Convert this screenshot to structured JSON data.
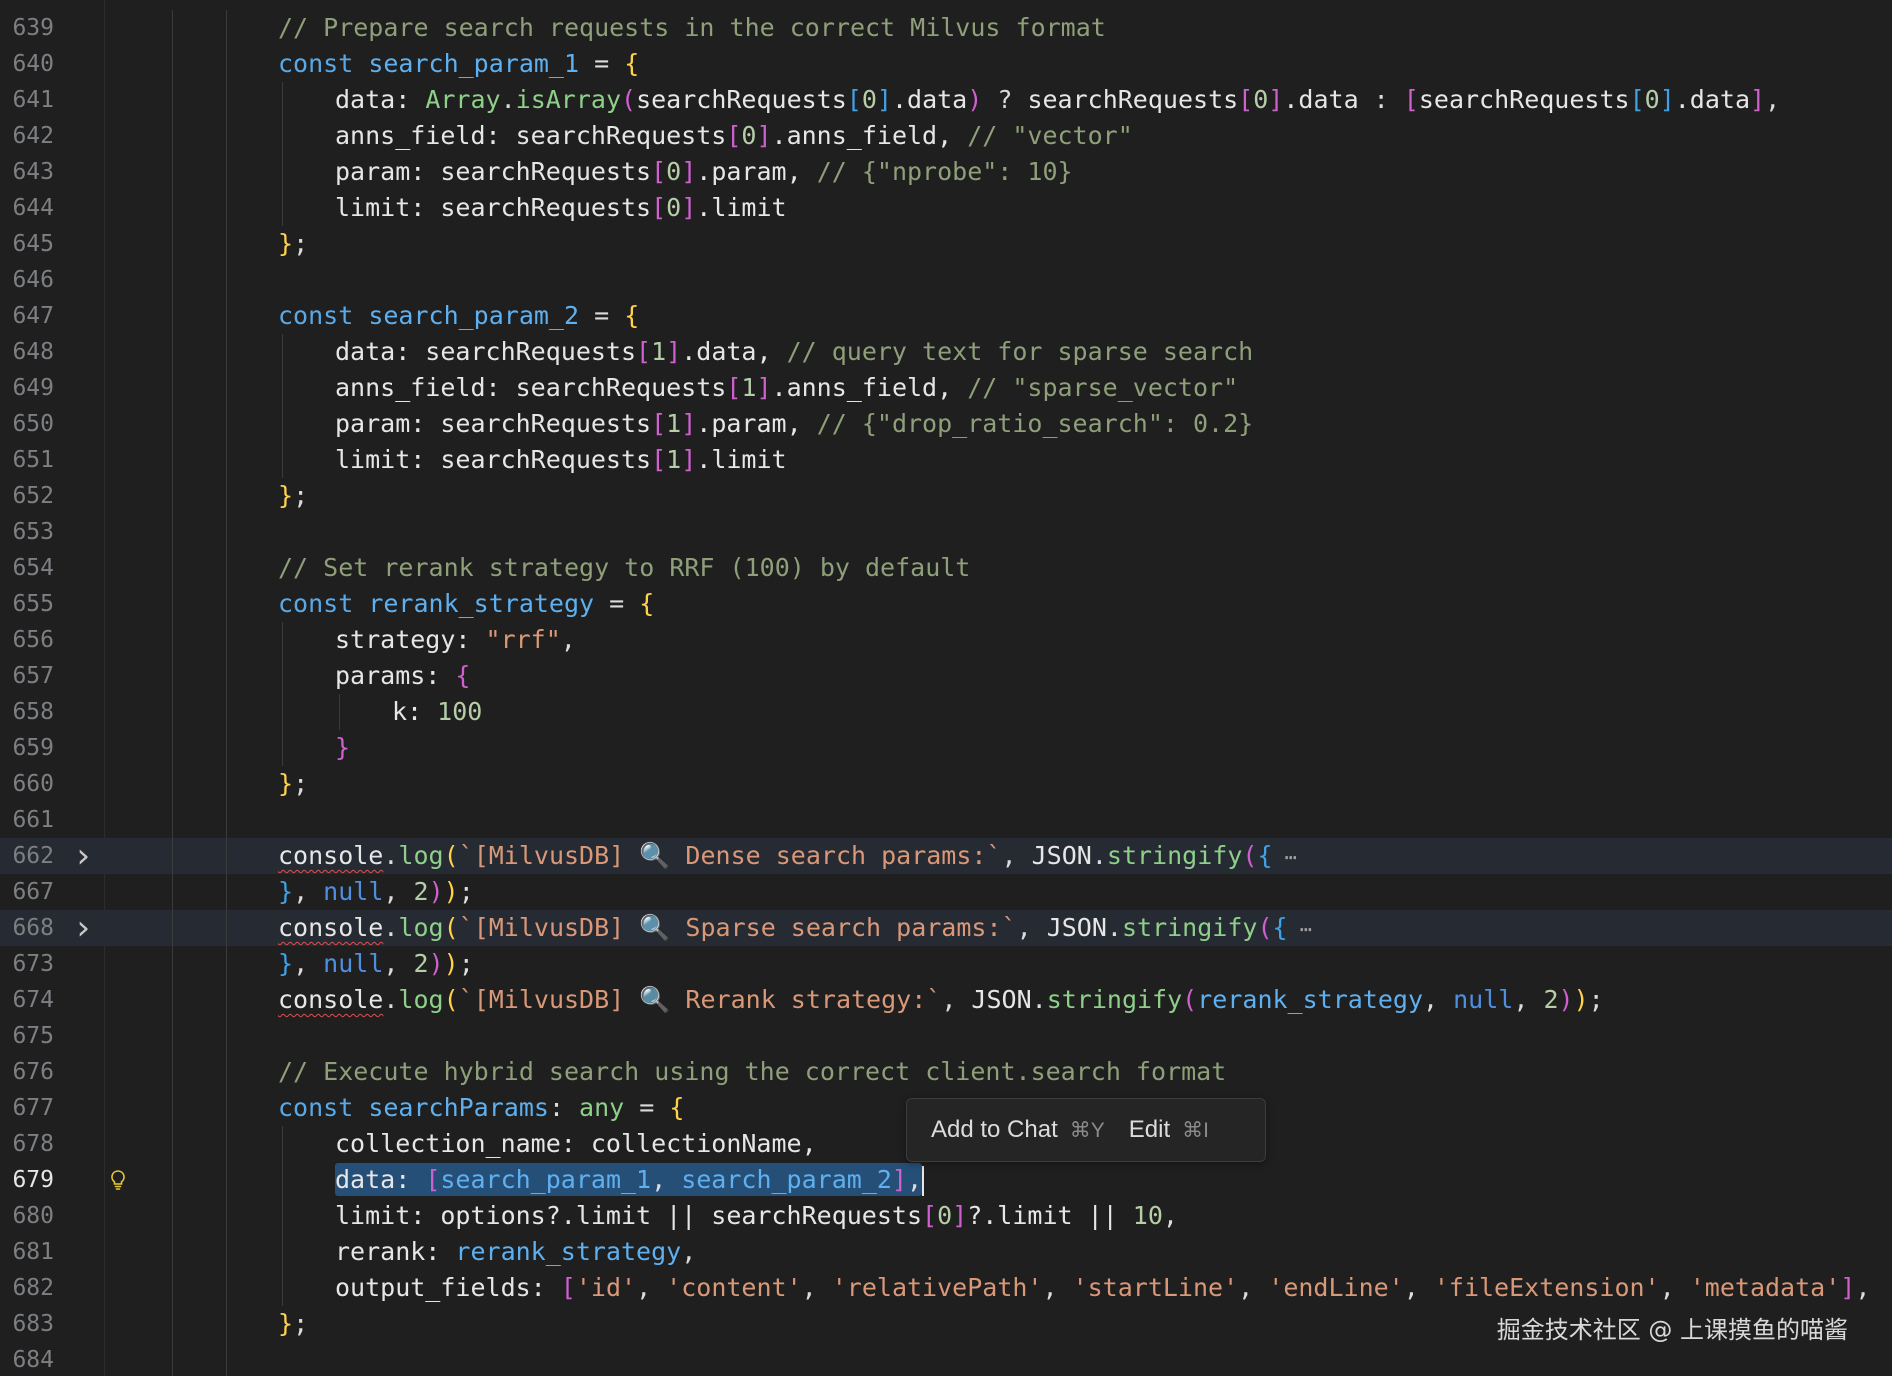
{
  "editor": {
    "lines": [
      {
        "num": "639",
        "tokens": [
          [
            "cm",
            "// Prepare search requests in the correct Milvus format"
          ]
        ],
        "indent": 1
      },
      {
        "num": "640",
        "tokens": [
          [
            "kw",
            "const "
          ],
          [
            "var",
            "search_param_1"
          ],
          [
            "pu",
            " = "
          ],
          [
            "b1",
            "{"
          ]
        ],
        "indent": 1
      },
      {
        "num": "641",
        "tokens": [
          [
            "prop",
            "data: "
          ],
          [
            "type",
            "Array"
          ],
          [
            "pu",
            "."
          ],
          [
            "fn",
            "isArray"
          ],
          [
            "b2",
            "("
          ],
          [
            "prop",
            "searchRequests"
          ],
          [
            "b3",
            "["
          ],
          [
            "num",
            "0"
          ],
          [
            "b3",
            "]"
          ],
          [
            "prop",
            ".data"
          ],
          [
            "b2",
            ")"
          ],
          [
            "pu",
            " ? "
          ],
          [
            "prop",
            "searchRequests"
          ],
          [
            "b2",
            "["
          ],
          [
            "num",
            "0"
          ],
          [
            "b2",
            "]"
          ],
          [
            "prop",
            ".data"
          ],
          [
            "pu",
            " : "
          ],
          [
            "b2",
            "["
          ],
          [
            "prop",
            "searchRequests"
          ],
          [
            "b3",
            "["
          ],
          [
            "num",
            "0"
          ],
          [
            "b3",
            "]"
          ],
          [
            "prop",
            ".data"
          ],
          [
            "b2",
            "]"
          ],
          [
            "pu",
            ","
          ]
        ],
        "indent": 2
      },
      {
        "num": "642",
        "tokens": [
          [
            "prop",
            "anns_field: searchRequests"
          ],
          [
            "b2",
            "["
          ],
          [
            "num",
            "0"
          ],
          [
            "b2",
            "]"
          ],
          [
            "prop",
            ".anns_field, "
          ],
          [
            "cm",
            "// \"vector\""
          ]
        ],
        "indent": 2
      },
      {
        "num": "643",
        "tokens": [
          [
            "prop",
            "param: searchRequests"
          ],
          [
            "b2",
            "["
          ],
          [
            "num",
            "0"
          ],
          [
            "b2",
            "]"
          ],
          [
            "prop",
            ".param, "
          ],
          [
            "cm",
            "// {\"nprobe\": 10}"
          ]
        ],
        "indent": 2
      },
      {
        "num": "644",
        "tokens": [
          [
            "prop",
            "limit: searchRequests"
          ],
          [
            "b2",
            "["
          ],
          [
            "num",
            "0"
          ],
          [
            "b2",
            "]"
          ],
          [
            "prop",
            ".limit"
          ]
        ],
        "indent": 2
      },
      {
        "num": "645",
        "tokens": [
          [
            "b1",
            "}"
          ],
          [
            "pu",
            ";"
          ]
        ],
        "indent": 1
      },
      {
        "num": "646",
        "tokens": [],
        "indent": 1
      },
      {
        "num": "647",
        "tokens": [
          [
            "kw",
            "const "
          ],
          [
            "var",
            "search_param_2"
          ],
          [
            "pu",
            " = "
          ],
          [
            "b1",
            "{"
          ]
        ],
        "indent": 1
      },
      {
        "num": "648",
        "tokens": [
          [
            "prop",
            "data: searchRequests"
          ],
          [
            "b2",
            "["
          ],
          [
            "num",
            "1"
          ],
          [
            "b2",
            "]"
          ],
          [
            "prop",
            ".data, "
          ],
          [
            "cm",
            "// query text for sparse search"
          ]
        ],
        "indent": 2
      },
      {
        "num": "649",
        "tokens": [
          [
            "prop",
            "anns_field: searchRequests"
          ],
          [
            "b2",
            "["
          ],
          [
            "num",
            "1"
          ],
          [
            "b2",
            "]"
          ],
          [
            "prop",
            ".anns_field, "
          ],
          [
            "cm",
            "// \"sparse_vector\""
          ]
        ],
        "indent": 2
      },
      {
        "num": "650",
        "tokens": [
          [
            "prop",
            "param: searchRequests"
          ],
          [
            "b2",
            "["
          ],
          [
            "num",
            "1"
          ],
          [
            "b2",
            "]"
          ],
          [
            "prop",
            ".param, "
          ],
          [
            "cm",
            "// {\"drop_ratio_search\": 0.2}"
          ]
        ],
        "indent": 2
      },
      {
        "num": "651",
        "tokens": [
          [
            "prop",
            "limit: searchRequests"
          ],
          [
            "b2",
            "["
          ],
          [
            "num",
            "1"
          ],
          [
            "b2",
            "]"
          ],
          [
            "prop",
            ".limit"
          ]
        ],
        "indent": 2
      },
      {
        "num": "652",
        "tokens": [
          [
            "b1",
            "}"
          ],
          [
            "pu",
            ";"
          ]
        ],
        "indent": 1
      },
      {
        "num": "653",
        "tokens": [],
        "indent": 1
      },
      {
        "num": "654",
        "tokens": [
          [
            "cm",
            "// Set rerank strategy to RRF (100) by default"
          ]
        ],
        "indent": 1
      },
      {
        "num": "655",
        "tokens": [
          [
            "kw",
            "const "
          ],
          [
            "var",
            "rerank_strategy"
          ],
          [
            "pu",
            " = "
          ],
          [
            "b1",
            "{"
          ]
        ],
        "indent": 1
      },
      {
        "num": "656",
        "tokens": [
          [
            "prop",
            "strategy: "
          ],
          [
            "str",
            "\"rrf\""
          ],
          [
            "pu",
            ","
          ]
        ],
        "indent": 2
      },
      {
        "num": "657",
        "tokens": [
          [
            "prop",
            "params: "
          ],
          [
            "b2",
            "{"
          ]
        ],
        "indent": 2
      },
      {
        "num": "658",
        "tokens": [
          [
            "prop",
            "k: "
          ],
          [
            "num",
            "100"
          ]
        ],
        "indent": 3
      },
      {
        "num": "659",
        "tokens": [
          [
            "b2",
            "}"
          ]
        ],
        "indent": 2
      },
      {
        "num": "660",
        "tokens": [
          [
            "b1",
            "}"
          ],
          [
            "pu",
            ";"
          ]
        ],
        "indent": 1
      },
      {
        "num": "661",
        "tokens": [],
        "indent": 1
      },
      {
        "num": "662",
        "fold": true,
        "tokens": [
          [
            "sq",
            "console"
          ],
          [
            "pu",
            "."
          ],
          [
            "fn",
            "log"
          ],
          [
            "b1",
            "("
          ],
          [
            "str",
            "`[MilvusDB] 🔍 Dense search params:`"
          ],
          [
            "pu",
            ", "
          ],
          [
            "prop",
            "JSON"
          ],
          [
            "pu",
            "."
          ],
          [
            "fn",
            "stringify"
          ],
          [
            "b2",
            "("
          ],
          [
            "b3",
            "{"
          ],
          [
            "el",
            " ⋯"
          ]
        ],
        "indent": 1
      },
      {
        "num": "667",
        "tokens": [
          [
            "b3",
            "}"
          ],
          [
            "pu",
            ", "
          ],
          [
            "null",
            "null"
          ],
          [
            "pu",
            ", "
          ],
          [
            "num",
            "2"
          ],
          [
            "b2",
            ")"
          ],
          [
            "b1",
            ")"
          ],
          [
            "pu",
            ";"
          ]
        ],
        "indent": 1
      },
      {
        "num": "668",
        "fold": true,
        "tokens": [
          [
            "sq",
            "console"
          ],
          [
            "pu",
            "."
          ],
          [
            "fn",
            "log"
          ],
          [
            "b1",
            "("
          ],
          [
            "str",
            "`[MilvusDB] 🔍 Sparse search params:`"
          ],
          [
            "pu",
            ", "
          ],
          [
            "prop",
            "JSON"
          ],
          [
            "pu",
            "."
          ],
          [
            "fn",
            "stringify"
          ],
          [
            "b2",
            "("
          ],
          [
            "b3",
            "{"
          ],
          [
            "el",
            " ⋯"
          ]
        ],
        "indent": 1
      },
      {
        "num": "673",
        "tokens": [
          [
            "b3",
            "}"
          ],
          [
            "pu",
            ", "
          ],
          [
            "null",
            "null"
          ],
          [
            "pu",
            ", "
          ],
          [
            "num",
            "2"
          ],
          [
            "b2",
            ")"
          ],
          [
            "b1",
            ")"
          ],
          [
            "pu",
            ";"
          ]
        ],
        "indent": 1
      },
      {
        "num": "674",
        "tokens": [
          [
            "sq",
            "console"
          ],
          [
            "pu",
            "."
          ],
          [
            "fn",
            "log"
          ],
          [
            "b1",
            "("
          ],
          [
            "str",
            "`[MilvusDB] 🔍 Rerank strategy:`"
          ],
          [
            "pu",
            ", "
          ],
          [
            "prop",
            "JSON"
          ],
          [
            "pu",
            "."
          ],
          [
            "fn",
            "stringify"
          ],
          [
            "b2",
            "("
          ],
          [
            "var",
            "rerank_strategy"
          ],
          [
            "pu",
            ", "
          ],
          [
            "null",
            "null"
          ],
          [
            "pu",
            ", "
          ],
          [
            "num",
            "2"
          ],
          [
            "b2",
            ")"
          ],
          [
            "b1",
            ")"
          ],
          [
            "pu",
            ";"
          ]
        ],
        "indent": 1
      },
      {
        "num": "675",
        "tokens": [],
        "indent": 1
      },
      {
        "num": "676",
        "tokens": [
          [
            "cm",
            "// Execute hybrid search using the correct client.search format"
          ]
        ],
        "indent": 1
      },
      {
        "num": "677",
        "tokens": [
          [
            "kw",
            "const "
          ],
          [
            "var",
            "searchParams"
          ],
          [
            "pu",
            ": "
          ],
          [
            "type",
            "any"
          ],
          [
            "pu",
            " = "
          ],
          [
            "b1",
            "{"
          ]
        ],
        "indent": 1
      },
      {
        "num": "678",
        "tokens": [
          [
            "prop",
            "collection_name: collectionName,"
          ]
        ],
        "indent": 2
      },
      {
        "num": "679",
        "active": true,
        "selected": true,
        "tokens": [
          [
            "prop",
            "data: "
          ],
          [
            "b2",
            "["
          ],
          [
            "var",
            "search_param_1"
          ],
          [
            "pu",
            ", "
          ],
          [
            "var",
            "search_param_2"
          ],
          [
            "b2",
            "]"
          ],
          [
            "pu",
            ","
          ]
        ],
        "indent": 2
      },
      {
        "num": "680",
        "tokens": [
          [
            "prop",
            "limit: options?.limit || searchRequests"
          ],
          [
            "b2",
            "["
          ],
          [
            "num",
            "0"
          ],
          [
            "b2",
            "]"
          ],
          [
            "prop",
            "?.limit || "
          ],
          [
            "num",
            "10"
          ],
          [
            "pu",
            ","
          ]
        ],
        "indent": 2
      },
      {
        "num": "681",
        "tokens": [
          [
            "prop",
            "rerank: "
          ],
          [
            "var",
            "rerank_strategy"
          ],
          [
            "pu",
            ","
          ]
        ],
        "indent": 2
      },
      {
        "num": "682",
        "tokens": [
          [
            "prop",
            "output_fields: "
          ],
          [
            "b2",
            "["
          ],
          [
            "str",
            "'id'"
          ],
          [
            "pu",
            ", "
          ],
          [
            "str",
            "'content'"
          ],
          [
            "pu",
            ", "
          ],
          [
            "str",
            "'relativePath'"
          ],
          [
            "pu",
            ", "
          ],
          [
            "str",
            "'startLine'"
          ],
          [
            "pu",
            ", "
          ],
          [
            "str",
            "'endLine'"
          ],
          [
            "pu",
            ", "
          ],
          [
            "str",
            "'fileExtension'"
          ],
          [
            "pu",
            ", "
          ],
          [
            "str",
            "'metadata'"
          ],
          [
            "b2",
            "]"
          ],
          [
            "pu",
            ","
          ]
        ],
        "indent": 2
      },
      {
        "num": "683",
        "tokens": [
          [
            "b1",
            "}"
          ],
          [
            "pu",
            ";"
          ]
        ],
        "indent": 1
      },
      {
        "num": "684",
        "tokens": [],
        "indent": 1
      }
    ]
  },
  "popup": {
    "add_to_chat_label": "Add to Chat",
    "add_to_chat_shortcut": "⌘Y",
    "edit_label": "Edit",
    "edit_shortcut": "⌘I"
  },
  "icons": {
    "fold": "chevron-right-icon",
    "bulb": "lightbulb-icon"
  },
  "watermark": "掘金技术社区 @ 上课摸鱼的喵酱"
}
